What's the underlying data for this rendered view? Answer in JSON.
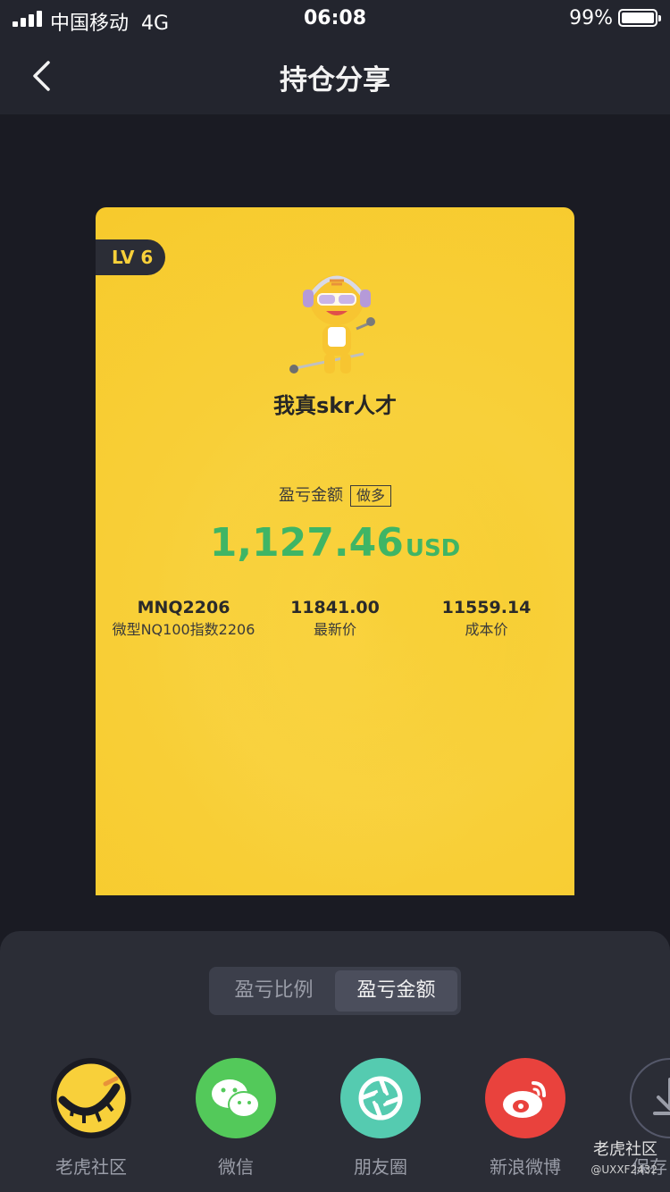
{
  "status_bar": {
    "carrier": "中国移动",
    "network": "4G",
    "time": "06:08",
    "battery_percent": "99%",
    "battery_level": 0.99
  },
  "nav": {
    "title": "持仓分享",
    "back_icon": "chevron-left-icon"
  },
  "card": {
    "level": "LV 6",
    "nickname": "我真skr人才",
    "pnl_label": "盈亏金额",
    "direction": "做多",
    "pnl_amount": "1,127.46",
    "pnl_currency": "USD",
    "pnl_color": "#3fb565",
    "background_color": "#f8d03a",
    "stats": [
      {
        "value": "MNQ2206",
        "label": "微型NQ100指数2206"
      },
      {
        "value": "11841.00",
        "label": "最新价"
      },
      {
        "value": "11559.14",
        "label": "成本价"
      }
    ]
  },
  "toggle": {
    "options": [
      {
        "label": "盈亏比例",
        "active": false
      },
      {
        "label": "盈亏金额",
        "active": true
      }
    ]
  },
  "share_targets": [
    {
      "label": "老虎社区",
      "icon": "tiger-community-icon",
      "color": "#f8d03a"
    },
    {
      "label": "微信",
      "icon": "wechat-icon",
      "color": "#53c95a"
    },
    {
      "label": "朋友圈",
      "icon": "moments-icon",
      "color": "#55cbb0"
    },
    {
      "label": "新浪微博",
      "icon": "weibo-icon",
      "color": "#e9423d"
    },
    {
      "label": "保存",
      "icon": "download-icon",
      "color": "#2b2d36"
    }
  ],
  "watermark": {
    "text": "老虎社区",
    "handle": "@UXXF2432"
  }
}
